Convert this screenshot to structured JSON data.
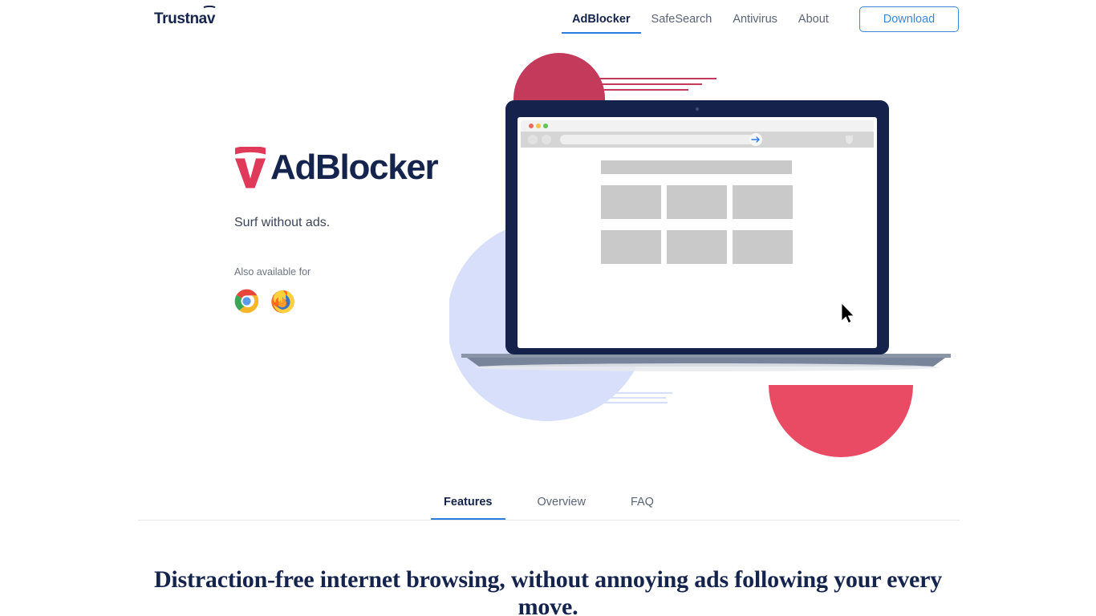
{
  "brand": {
    "name": "Trustnav",
    "mark_icon": "shield-chevron-icon"
  },
  "nav": {
    "items": [
      {
        "label": "AdBlocker",
        "active": true
      },
      {
        "label": "SafeSearch",
        "active": false
      },
      {
        "label": "Antivirus",
        "active": false
      },
      {
        "label": "About",
        "active": false
      }
    ],
    "cta": {
      "label": "Download"
    }
  },
  "hero": {
    "product_name": "AdBlocker",
    "product_mark_icon": "shield-v-icon",
    "tagline": "Surf without ads.",
    "availability_label": "Also available for",
    "browsers": [
      {
        "name": "Google Chrome",
        "icon": "chrome-icon"
      },
      {
        "name": "Mozilla Firefox",
        "icon": "firefox-icon"
      }
    ],
    "illustration": {
      "device": "laptop",
      "browser_mockup": {
        "traffic_lights": [
          "#ec6a5e",
          "#f4bf4f",
          "#61c454"
        ],
        "address_bar_icon": "arrow-right-icon",
        "toolbar_shield_icon": "shield-icon",
        "placeholder_banner_count": 1,
        "placeholder_tile_count": 6
      },
      "cursor_icon": "mouse-pointer-icon"
    }
  },
  "tabs": [
    {
      "label": "Features",
      "active": true
    },
    {
      "label": "Overview",
      "active": false
    },
    {
      "label": "FAQ",
      "active": false
    }
  ],
  "section": {
    "headline": "Distraction-free internet browsing, without annoying ads following your every move."
  },
  "colors": {
    "brand_navy": "#15244d",
    "accent_blue": "#2b7de0",
    "accent_crimson": "#e94560",
    "accent_dark_crimson": "#c33a5a",
    "lavender": "#d7dffa",
    "placeholder_grey": "#c9c9c9"
  }
}
